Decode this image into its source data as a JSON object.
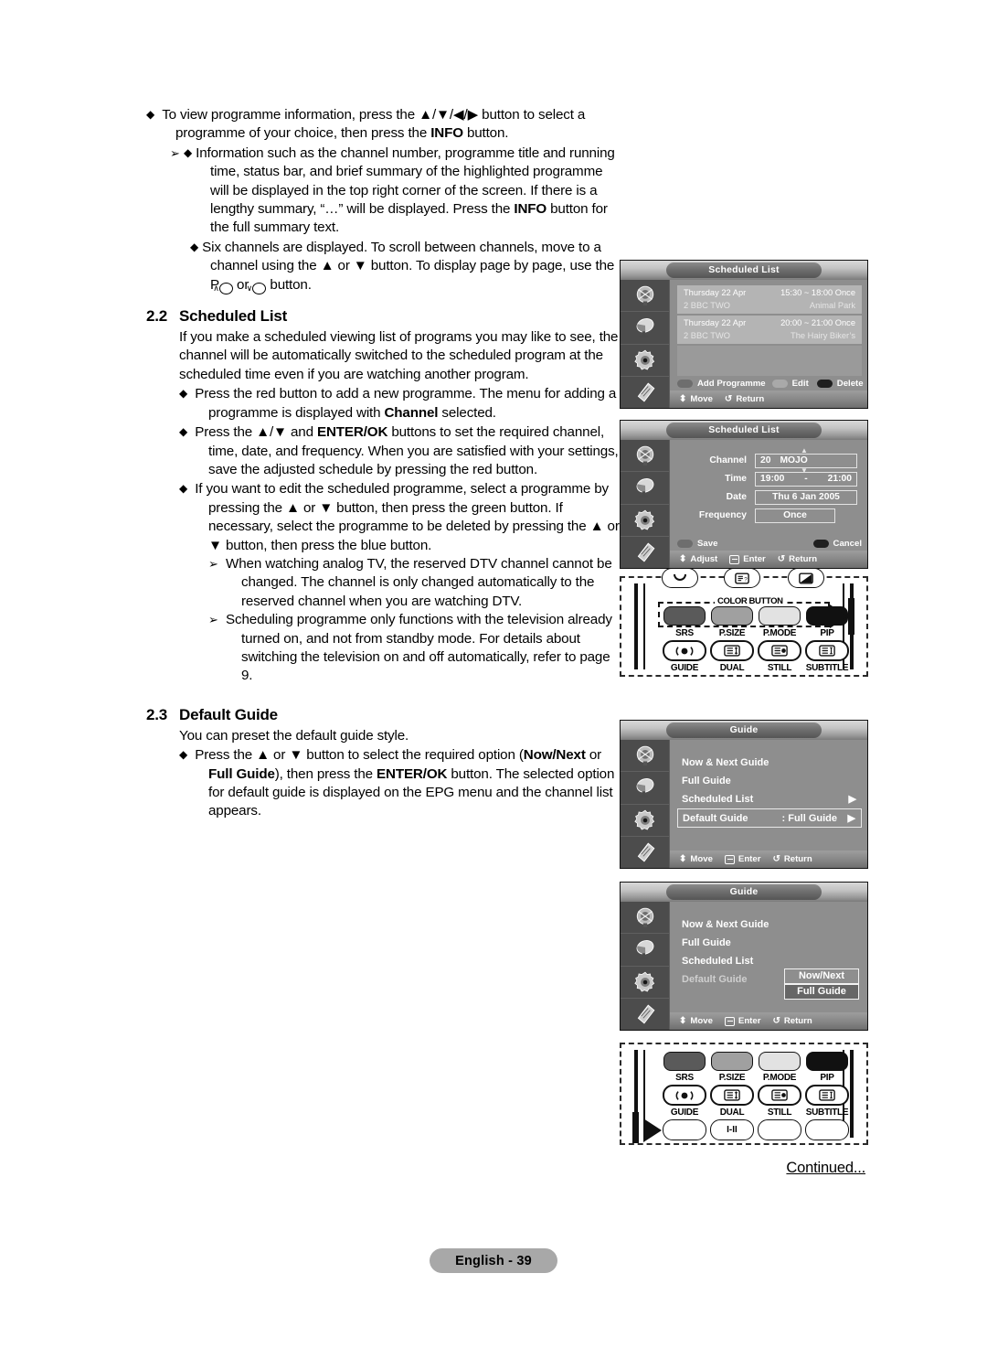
{
  "page": {
    "footer_label": "English - 39",
    "continued": "Continued..."
  },
  "intro": {
    "b1": "To view programme information, press the ▲/▼/◀/▶ button to select a programme of your choice, then press the ",
    "b1_bold": "INFO",
    "b1_end": " button.",
    "b2": "Information such as the channel number, programme title and running time, status bar, and brief summary of the highlighted programme will be displayed in the top right corner of the screen. If there is a lengthy summary, “…” will be displayed. Press the ",
    "b2_bold": "INFO",
    "b2_end": " button for the full summary text.",
    "b3": "Six channels are displayed. To scroll between channels, move to a channel using the ▲ or ▼ button. To display page by page, use the P",
    "b3_end": " button."
  },
  "section22": {
    "number": "2.2",
    "title": "Scheduled List",
    "intro": "If you make a scheduled viewing list of programs you may like to see, the channel will be automatically switched to the scheduled program at the scheduled time even if you are watching another program.",
    "b1_a": "Press the red button to add a new programme. The menu for adding a programme is displayed with ",
    "b1_bold": "Channel",
    "b1_b": " selected.",
    "b2_a": "Press the ▲/▼ and ",
    "b2_bold": "ENTER/OK",
    "b2_b": " buttons to set the required channel, time, date, and frequency. When you are satisfied with your settings, save the adjusted schedule by pressing the red button.",
    "b3": "If you want to edit the scheduled programme, select a programme by pressing the ▲ or ▼ button, then press the green button. If necessary, select the programme to be deleted by pressing the ▲ or ▼ button, then press the blue button.",
    "n1": "When watching analog TV, the reserved DTV channel cannot be changed. The channel is only changed automatically to the reserved channel when you are watching DTV.",
    "n2": "Scheduling programme only functions with the television already turned on, and not from standby mode. For details about switching the television on and off automatically, refer to page 9."
  },
  "section23": {
    "number": "2.3",
    "title": "Default Guide",
    "intro": "You can preset the default guide style.",
    "b1_a": "Press the ▲ or ▼ button to select the required option (",
    "b1_bold1": "Now/Next",
    "b1_mid": " or ",
    "b1_bold2": "Full Guide",
    "b1_b": "), then press the ",
    "b1_bold3": "ENTER/OK",
    "b1_c": " button. The selected option for default guide is displayed on the EPG menu and the channel list appears."
  },
  "osd_scheduled_list": {
    "title": "Scheduled List",
    "rows": [
      {
        "date": "Thursday 22 Apr",
        "time": "15:30 ~ 18:00 Once",
        "channel": "2 BBC TWO",
        "programme": "Animal Park"
      },
      {
        "date": "Thursday 22 Apr",
        "time": "20:00 ~ 21:00 Once",
        "channel": "2 BBC TWO",
        "programme": "The Hairy Biker’s"
      }
    ],
    "color_buttons": [
      {
        "label": "Add Programme",
        "color": "#6e6e6e"
      },
      {
        "label": "Edit",
        "color": "#a9a9a9"
      },
      {
        "label": "Delete",
        "color": "#1f1f1f"
      }
    ],
    "footer": [
      {
        "glyph": "⬍",
        "label": "Move"
      },
      {
        "glyph": "↺",
        "label": "Return"
      }
    ]
  },
  "osd_schedule_edit": {
    "title": "Scheduled List",
    "fields": [
      {
        "label": "Channel",
        "value_num": "20",
        "value_name": "MOJO"
      },
      {
        "label": "Time",
        "from": "19:00",
        "sep": "-",
        "to": "21:00"
      },
      {
        "label": "Date",
        "value": "Thu 6 Jan 2005"
      },
      {
        "label": "Frequency",
        "value": "Once"
      }
    ],
    "color_buttons": [
      {
        "label": "Save",
        "color": "#6e6e6e"
      },
      {
        "label": "Cancel",
        "color": "#1f1f1f"
      }
    ],
    "footer": [
      {
        "glyph": "⬍",
        "label": "Adjust"
      },
      {
        "glyph": "⏎",
        "label": "Enter"
      },
      {
        "glyph": "↺",
        "label": "Return"
      }
    ]
  },
  "osd_guide_1": {
    "title": "Guide",
    "items": [
      {
        "label": "Now & Next Guide",
        "arrow": "",
        "value": ""
      },
      {
        "label": "Full Guide",
        "arrow": "",
        "value": ""
      },
      {
        "label": "Scheduled List",
        "arrow": "▶",
        "value": ""
      },
      {
        "label": "Default Guide",
        "arrow": "▶",
        "value": ": Full Guide"
      }
    ],
    "footer": [
      {
        "glyph": "⬍",
        "label": "Move"
      },
      {
        "glyph": "⏎",
        "label": "Enter"
      },
      {
        "glyph": "↺",
        "label": "Return"
      }
    ]
  },
  "osd_guide_2": {
    "title": "Guide",
    "items": [
      {
        "label": "Now & Next Guide"
      },
      {
        "label": "Full Guide"
      },
      {
        "label": "Scheduled List"
      },
      {
        "label": "Default Guide",
        "colon": ":"
      }
    ],
    "dropdown": [
      {
        "label": "Now/Next",
        "selected": false
      },
      {
        "label": "Full Guide",
        "selected": true
      }
    ],
    "footer": [
      {
        "glyph": "⬍",
        "label": "Move"
      },
      {
        "glyph": "⏎",
        "label": "Enter"
      },
      {
        "glyph": "↺",
        "label": "Return"
      }
    ]
  },
  "remote_top": {
    "color_group_label": "COLOR BUTTON",
    "color_buttons": [
      {
        "label": "SRS",
        "color": "#5a5a5a"
      },
      {
        "label": "P.SIZE",
        "color": "#a0a0a0"
      },
      {
        "label": "P.MODE",
        "color": "#e2e2e2"
      },
      {
        "label": "PIP",
        "color": "#111111"
      }
    ],
    "lower_labels": [
      "GUIDE",
      "DUAL",
      "STILL",
      "SUBTITLE"
    ]
  },
  "remote_bottom": {
    "color_buttons": [
      {
        "label": "SRS",
        "color": "#5a5a5a"
      },
      {
        "label": "P.SIZE",
        "color": "#a0a0a0"
      },
      {
        "label": "P.MODE",
        "color": "#e2e2e2"
      },
      {
        "label": "PIP",
        "color": "#111111"
      }
    ],
    "lower_labels": [
      "GUIDE",
      "DUAL",
      "STILL",
      "SUBTITLE"
    ],
    "dual_glyph": "I-II"
  }
}
